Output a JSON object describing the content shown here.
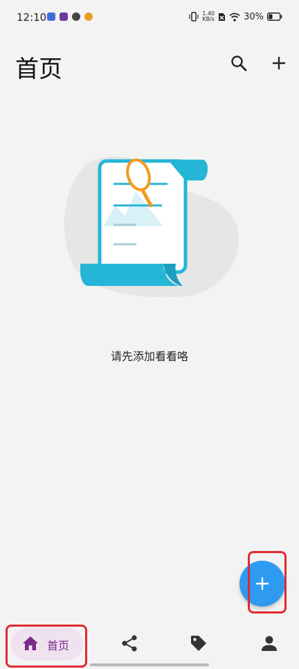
{
  "status_bar": {
    "time": "12:10",
    "net_speed_value": "1.40",
    "net_speed_unit": "KB/s",
    "battery": "30%"
  },
  "app_bar": {
    "title": "首页",
    "search_icon": "search-icon",
    "add_icon": "plus-icon"
  },
  "empty_state": {
    "message": "请先添加看看咯",
    "illustration": "scroll-magnifier-illustration"
  },
  "fab": {
    "icon": "plus-icon",
    "color": "#2f9bf0"
  },
  "bottom_nav": {
    "items": [
      {
        "label": "首页",
        "icon": "home-icon",
        "selected": true
      },
      {
        "label": "",
        "icon": "share-icon",
        "selected": false
      },
      {
        "label": "",
        "icon": "tag-icon",
        "selected": false
      },
      {
        "label": "",
        "icon": "person-icon",
        "selected": false
      }
    ]
  },
  "colors": {
    "accent": "#7a2a8a",
    "selected_pill": "#efe2ef",
    "annotation": "#e02a2f",
    "background": "#f3f3f3"
  }
}
